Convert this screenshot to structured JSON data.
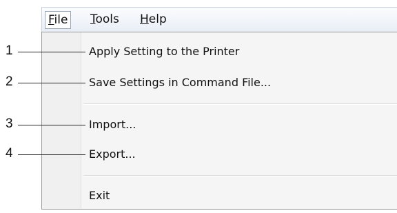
{
  "menubar": {
    "items": [
      {
        "mnemonic": "F",
        "rest": "ile",
        "active": true
      },
      {
        "mnemonic": "T",
        "rest": "ools",
        "active": false
      },
      {
        "mnemonic": "H",
        "rest": "elp",
        "active": false
      }
    ]
  },
  "file_menu": {
    "items": [
      {
        "label": "Apply Setting to the Printer"
      },
      {
        "label": "Save Settings in Command File..."
      },
      {
        "label": "Import..."
      },
      {
        "label": "Export..."
      },
      {
        "label": "Exit"
      }
    ]
  },
  "callouts": [
    "1",
    "2",
    "3",
    "4"
  ]
}
